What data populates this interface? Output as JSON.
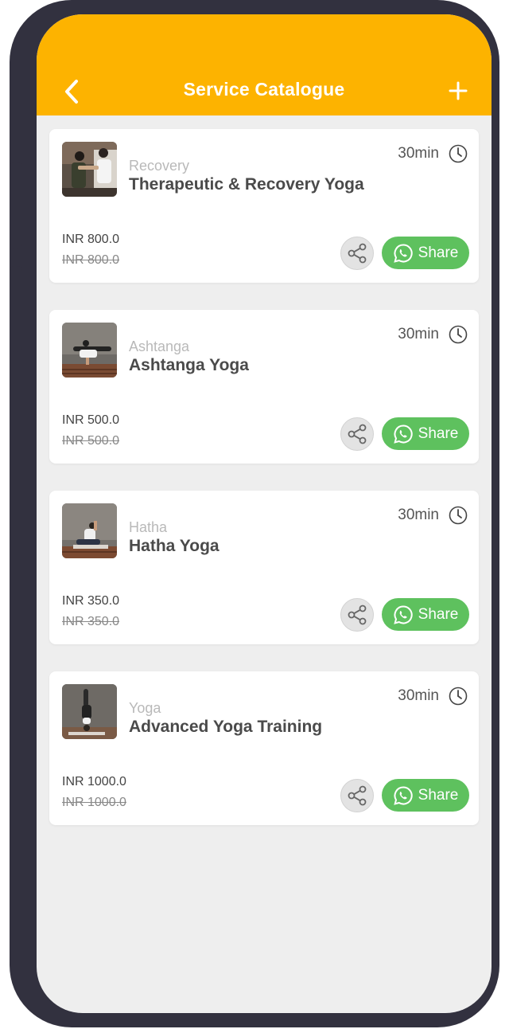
{
  "header": {
    "title": "Service Catalogue",
    "back_icon": "chevron-left-icon",
    "add_icon": "plus-icon",
    "background": "#fdb300"
  },
  "share_label": "Share",
  "services": [
    {
      "category": "Recovery",
      "name": "Therapeutic & Recovery Yoga",
      "duration": "30min",
      "price": "INR 800.0",
      "original_price": "INR 800.0"
    },
    {
      "category": "Ashtanga",
      "name": "Ashtanga Yoga",
      "duration": "30min",
      "price": "INR 500.0",
      "original_price": "INR 500.0"
    },
    {
      "category": "Hatha",
      "name": "Hatha Yoga",
      "duration": "30min",
      "price": "INR 350.0",
      "original_price": "INR 350.0"
    },
    {
      "category": "Yoga",
      "name": "Advanced Yoga Training",
      "duration": "30min",
      "price": "INR 1000.0",
      "original_price": "INR 1000.0"
    }
  ],
  "colors": {
    "accent": "#fdb300",
    "whatsapp_green": "#5ec15e",
    "frame": "#32313f"
  }
}
